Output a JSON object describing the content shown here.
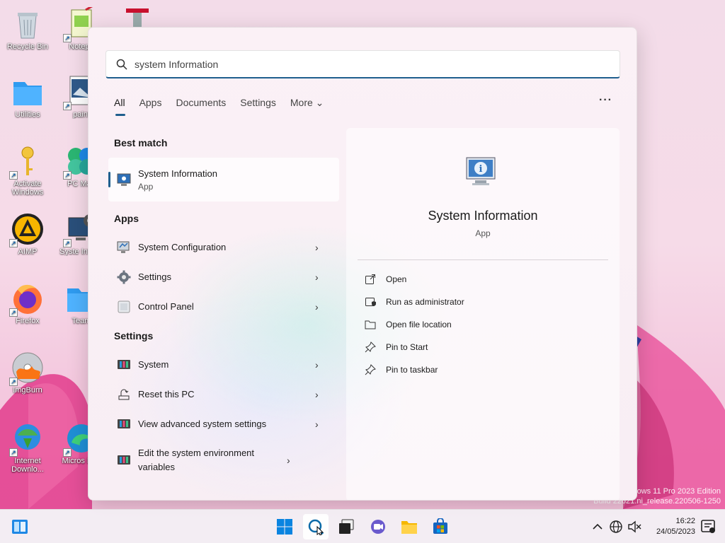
{
  "desktop": {
    "icons": [
      {
        "label": "Recycle Bin",
        "icon": "recycle-bin-icon"
      },
      {
        "label": "Notepa",
        "icon": "notepad-icon"
      },
      {
        "label": "Utilities",
        "icon": "folder-icon"
      },
      {
        "label": "paint",
        "icon": "paint-icon"
      },
      {
        "label": "Activate Windows",
        "icon": "key-icon"
      },
      {
        "label": "PC Man",
        "icon": "pc-manager-icon"
      },
      {
        "label": "AIMP",
        "icon": "aimp-icon"
      },
      {
        "label": "Syste Inform",
        "icon": "system-info-icon"
      },
      {
        "label": "Firefox",
        "icon": "firefox-icon"
      },
      {
        "label": "Team",
        "icon": "folder-icon"
      },
      {
        "label": "ImgBurn",
        "icon": "imgburn-icon"
      },
      {
        "label": "Internet Downlo...",
        "icon": "idm-icon"
      },
      {
        "label": "Micros Edg",
        "icon": "edge-icon"
      }
    ]
  },
  "search": {
    "query": "system Information"
  },
  "tabs": [
    {
      "label": "All",
      "active": true
    },
    {
      "label": "Apps"
    },
    {
      "label": "Documents"
    },
    {
      "label": "Settings"
    },
    {
      "label": "More ⌄"
    }
  ],
  "more_options": "···",
  "best_match": {
    "title": "Best match",
    "name": "System Information",
    "type": "App"
  },
  "apps": {
    "title": "Apps",
    "items": [
      {
        "label": "System Configuration"
      },
      {
        "label": "Settings"
      },
      {
        "label": "Control Panel"
      }
    ]
  },
  "settings": {
    "title": "Settings",
    "items": [
      {
        "label": "System"
      },
      {
        "label": "Reset this PC"
      },
      {
        "label": "View advanced system settings"
      },
      {
        "label": "Edit the system environment variables"
      }
    ]
  },
  "preview": {
    "name": "System Information",
    "type": "App",
    "actions": [
      {
        "label": "Open",
        "icon": "open-external-icon"
      },
      {
        "label": "Run as administrator",
        "icon": "shield-admin-icon"
      },
      {
        "label": "Open file location",
        "icon": "folder-open-icon"
      },
      {
        "label": "Pin to Start",
        "icon": "pin-icon"
      },
      {
        "label": "Pin to taskbar",
        "icon": "pin-icon"
      }
    ]
  },
  "watermark": {
    "line1": "ows 11 Pro 2023 Edition",
    "line2": "Build 22621.ni_release.220506-1250"
  },
  "taskbar": {
    "time": "16:22",
    "date": "24/05/2023"
  },
  "colors": {
    "accent": "#1f5f8e",
    "panel_bg": "#f8eef4"
  }
}
